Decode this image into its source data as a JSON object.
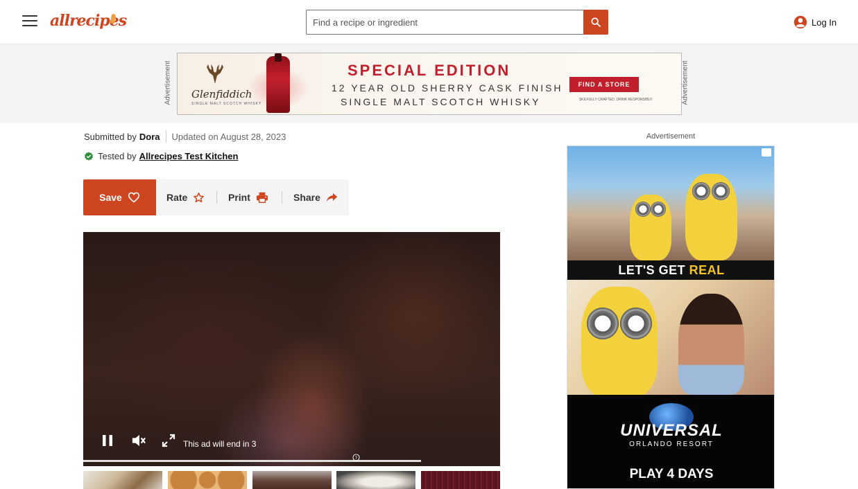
{
  "header": {
    "logo_text": "allrecipes",
    "search_placeholder": "Find a recipe or ingredient",
    "login_label": "Log In"
  },
  "banner_ad": {
    "side_label": "Advertisement",
    "brand": "Glenfiddich",
    "brand_sub": "SINGLE MALT SCOTCH WHISKY",
    "headline": "SPECIAL EDITION",
    "line1": "12 YEAR OLD SHERRY CASK FINISH",
    "line2": "SINGLE MALT SCOTCH WHISKY",
    "cta": "FIND A STORE",
    "fine_print": "SKILFULLY CRAFTED. DRINK RESPONSIBLY."
  },
  "byline": {
    "submitted_prefix": "Submitted by",
    "author": "Dora",
    "updated": "Updated on August 28, 2023",
    "tested_prefix": "Tested by",
    "tester": "Allrecipes Test Kitchen"
  },
  "actions": {
    "save": "Save",
    "rate": "Rate",
    "print": "Print",
    "share": "Share"
  },
  "video": {
    "ad_countdown": "This ad will end in 3",
    "progress": 0.81
  },
  "side_ad": {
    "label": "Advertisement",
    "strip_prefix": "LET'S GET ",
    "strip_highlight": "REAL",
    "brand": "UNIVERSAL",
    "brand_sub": "ORLANDO RESORT",
    "offer": "PLAY 4 DAYS"
  },
  "colors": {
    "brand": "#ce4620",
    "action_bg": "#f4f4f4",
    "video_bg": "#1f1512",
    "ad_bg": "#f4f4f4"
  }
}
